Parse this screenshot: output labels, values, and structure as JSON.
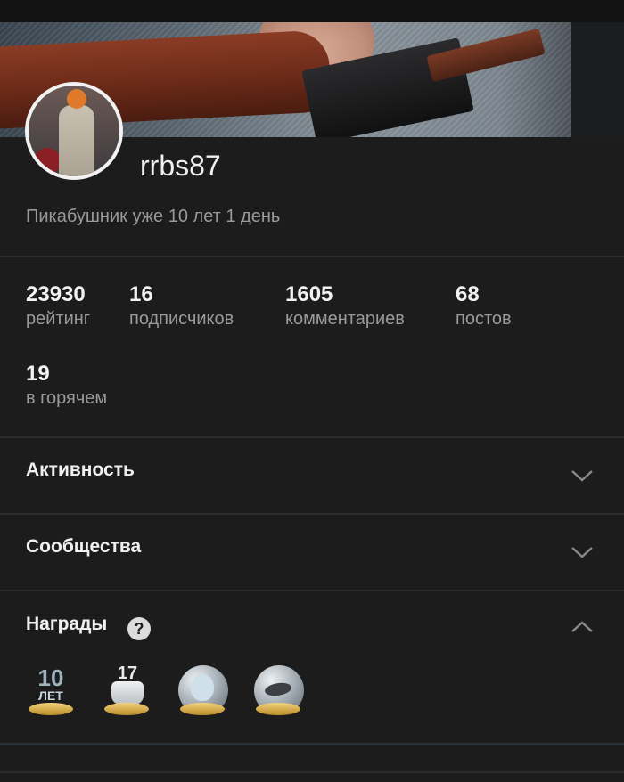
{
  "profile": {
    "username": "rrbs87",
    "member_since": "Пикабушник уже 10 лет 1 день"
  },
  "stats": [
    {
      "value": "23930",
      "label": "рейтинг"
    },
    {
      "value": "16",
      "label": "подписчиков"
    },
    {
      "value": "1605",
      "label": "комментариев"
    },
    {
      "value": "68",
      "label": "постов"
    },
    {
      "value": "19",
      "label": "в горячем"
    }
  ],
  "sections": {
    "activity": {
      "title": "Активность",
      "expanded": false
    },
    "communities": {
      "title": "Сообщества",
      "expanded": false
    },
    "awards": {
      "title": "Награды",
      "expanded": true,
      "help_icon": "?"
    }
  },
  "awards": [
    {
      "icon": "ten-years-award-icon",
      "text_top": "10",
      "text_bottom": "ЛЕТ"
    },
    {
      "icon": "birthday-cake-award-icon",
      "text_top": "17"
    },
    {
      "icon": "bunny-globe-award-icon"
    },
    {
      "icon": "bird-globe-award-icon"
    }
  ],
  "colors": {
    "background": "#1c1c1d",
    "text_primary": "#f0f0f0",
    "text_secondary": "#9a9a9c",
    "divider": "#2e2e30"
  }
}
